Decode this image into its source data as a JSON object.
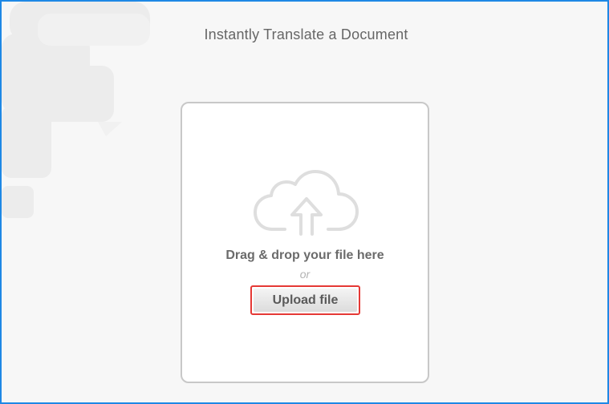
{
  "page": {
    "title": "Instantly Translate a Document"
  },
  "drop_zone": {
    "drag_text": "Drag & drop your file here",
    "or_text": "or",
    "upload_label": "Upload file",
    "icon": "cloud-upload-icon"
  },
  "colors": {
    "frame_border": "#1e88e5",
    "highlight": "#e53935",
    "text": "#666666",
    "muted": "#b3b3b3"
  }
}
